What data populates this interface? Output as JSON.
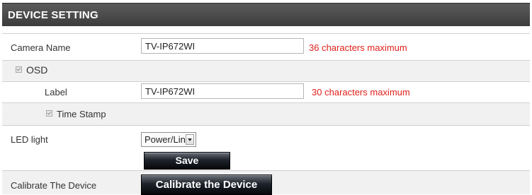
{
  "header": {
    "title": "DEVICE SETTING"
  },
  "camera_name": {
    "label": "Camera Name",
    "value": "TV-IP672WI",
    "hint": "36 characters maximum"
  },
  "osd": {
    "label": "OSD",
    "checked": true,
    "label_field": {
      "label": "Label",
      "value": "TV-IP672WI",
      "hint": "30 characters maximum"
    },
    "time_stamp": {
      "label": "Time Stamp",
      "checked": true
    }
  },
  "led_light": {
    "label": "LED light",
    "selected": "Power/Link"
  },
  "save_button": {
    "label": "Save"
  },
  "calibrate": {
    "label": "Calibrate The Device",
    "button_label": "Calibrate the Device"
  },
  "colors": {
    "header_bg": "#4a4a4a",
    "row_alt_bg": "#f1f1f1",
    "hint_red": "#e0201a",
    "button_bg": "#0f1318"
  }
}
